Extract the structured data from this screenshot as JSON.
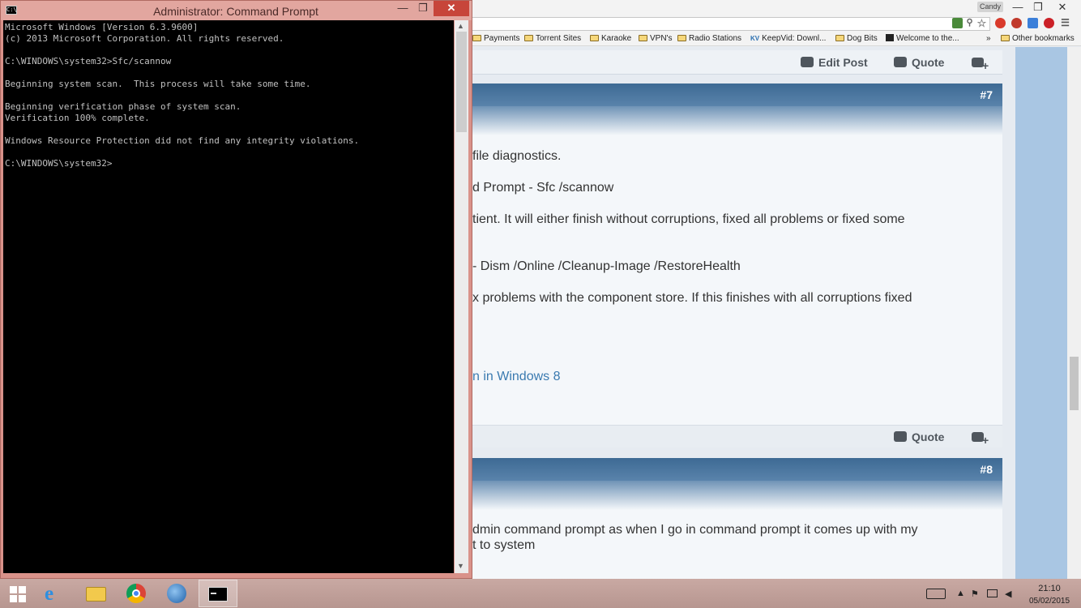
{
  "browser": {
    "user_badge": "Candy",
    "bookmarks": [
      {
        "label": "Payments"
      },
      {
        "label": "Torrent Sites"
      },
      {
        "label": "Karaoke"
      },
      {
        "label": "VPN's"
      },
      {
        "label": "Radio Stations"
      },
      {
        "label": "KeepVid: Downl..."
      },
      {
        "label": "Dog Bits"
      },
      {
        "label": "Welcome to the..."
      }
    ],
    "bookmarks_overflow": "»",
    "other_bookmarks": "Other bookmarks",
    "kv_badge": "KV"
  },
  "forum": {
    "edit_post": "Edit Post",
    "quote": "Quote",
    "post7": {
      "number": "#7",
      "lines": [
        "file diagnostics.",
        "d Prompt - Sfc /scannow",
        "tient. It will either finish without corruptions, fixed all problems or fixed some",
        "- Dism /Online /Cleanup-Image /RestoreHealth",
        "x problems with the component store. If this finishes with all corruptions fixed"
      ],
      "link": "n in Windows 8"
    },
    "post8": {
      "number": "#8",
      "lines": [
        "dmin command prompt as when I go in command prompt it comes up with my",
        "t to system"
      ]
    }
  },
  "cmd": {
    "title": "Administrator: Command Prompt",
    "sys_icon": "C:\\",
    "lines": [
      "Microsoft Windows [Version 6.3.9600]",
      "(c) 2013 Microsoft Corporation. All rights reserved.",
      "",
      "C:\\WINDOWS\\system32>Sfc/scannow",
      "",
      "Beginning system scan.  This process will take some time.",
      "",
      "Beginning verification phase of system scan.",
      "Verification 100% complete.",
      "",
      "Windows Resource Protection did not find any integrity violations.",
      "",
      "C:\\WINDOWS\\system32>"
    ]
  },
  "taskbar": {
    "time": "21:10",
    "date": "05/02/2015"
  }
}
